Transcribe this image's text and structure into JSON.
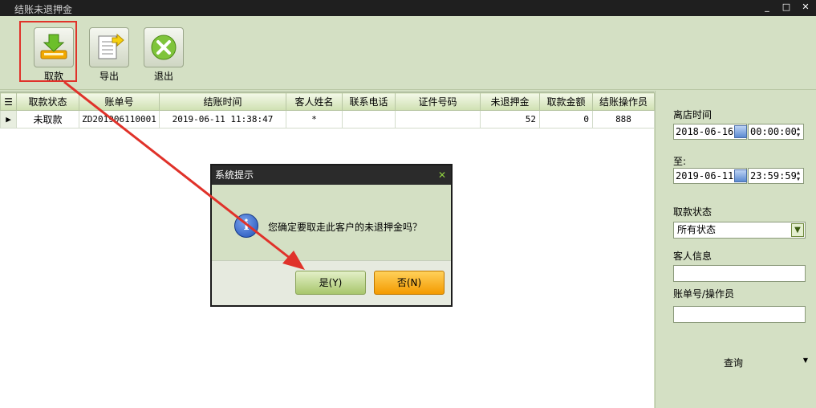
{
  "window": {
    "title": "结账未退押金"
  },
  "toolbar": {
    "withdraw_label": "取款",
    "export_label": "导出",
    "exit_label": "退出"
  },
  "table": {
    "headers": [
      "取款状态",
      "账单号",
      "结账时间",
      "客人姓名",
      "联系电话",
      "证件号码",
      "未退押金",
      "取款金额",
      "结账操作员"
    ],
    "rows": [
      [
        "未取款",
        "ZD201906110001",
        "2019-06-11 11:38:47",
        "*",
        "",
        "",
        "52",
        "0",
        "888"
      ]
    ]
  },
  "filters": {
    "departure_label": "离店时间",
    "start_date": "2018-06-16",
    "start_time": "00:00:00",
    "to_label": "至:",
    "end_date": "2019-06-11",
    "end_time": "23:59:59",
    "status_label": "取款状态",
    "status_value": "所有状态",
    "guest_label": "客人信息",
    "bill_label": "账单号/操作员",
    "query_label": "查询"
  },
  "dialog": {
    "title": "系统提示",
    "message": "您确定要取走此客户的未退押金吗？",
    "yes_label": "是(Y)",
    "no_label": "否(N)"
  },
  "colors": {
    "accent_red": "#e0322a",
    "panel_green": "#d4e0c4",
    "yes_green": "#a8c66c",
    "no_orange": "#f49a00"
  }
}
